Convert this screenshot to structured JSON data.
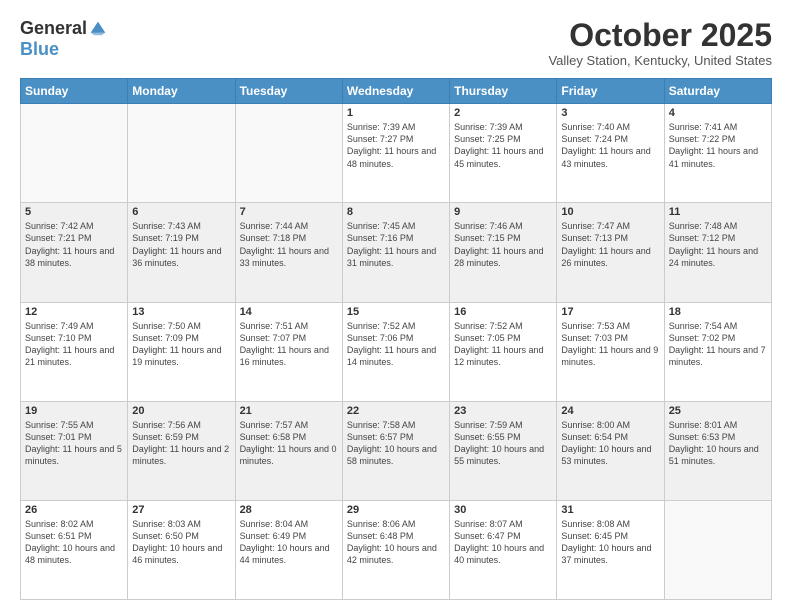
{
  "logo": {
    "general": "General",
    "blue": "Blue"
  },
  "header": {
    "month": "October 2025",
    "location": "Valley Station, Kentucky, United States"
  },
  "weekdays": [
    "Sunday",
    "Monday",
    "Tuesday",
    "Wednesday",
    "Thursday",
    "Friday",
    "Saturday"
  ],
  "weeks": [
    [
      {
        "day": "",
        "info": ""
      },
      {
        "day": "",
        "info": ""
      },
      {
        "day": "",
        "info": ""
      },
      {
        "day": "1",
        "info": "Sunrise: 7:39 AM\nSunset: 7:27 PM\nDaylight: 11 hours and 48 minutes."
      },
      {
        "day": "2",
        "info": "Sunrise: 7:39 AM\nSunset: 7:25 PM\nDaylight: 11 hours and 45 minutes."
      },
      {
        "day": "3",
        "info": "Sunrise: 7:40 AM\nSunset: 7:24 PM\nDaylight: 11 hours and 43 minutes."
      },
      {
        "day": "4",
        "info": "Sunrise: 7:41 AM\nSunset: 7:22 PM\nDaylight: 11 hours and 41 minutes."
      }
    ],
    [
      {
        "day": "5",
        "info": "Sunrise: 7:42 AM\nSunset: 7:21 PM\nDaylight: 11 hours and 38 minutes."
      },
      {
        "day": "6",
        "info": "Sunrise: 7:43 AM\nSunset: 7:19 PM\nDaylight: 11 hours and 36 minutes."
      },
      {
        "day": "7",
        "info": "Sunrise: 7:44 AM\nSunset: 7:18 PM\nDaylight: 11 hours and 33 minutes."
      },
      {
        "day": "8",
        "info": "Sunrise: 7:45 AM\nSunset: 7:16 PM\nDaylight: 11 hours and 31 minutes."
      },
      {
        "day": "9",
        "info": "Sunrise: 7:46 AM\nSunset: 7:15 PM\nDaylight: 11 hours and 28 minutes."
      },
      {
        "day": "10",
        "info": "Sunrise: 7:47 AM\nSunset: 7:13 PM\nDaylight: 11 hours and 26 minutes."
      },
      {
        "day": "11",
        "info": "Sunrise: 7:48 AM\nSunset: 7:12 PM\nDaylight: 11 hours and 24 minutes."
      }
    ],
    [
      {
        "day": "12",
        "info": "Sunrise: 7:49 AM\nSunset: 7:10 PM\nDaylight: 11 hours and 21 minutes."
      },
      {
        "day": "13",
        "info": "Sunrise: 7:50 AM\nSunset: 7:09 PM\nDaylight: 11 hours and 19 minutes."
      },
      {
        "day": "14",
        "info": "Sunrise: 7:51 AM\nSunset: 7:07 PM\nDaylight: 11 hours and 16 minutes."
      },
      {
        "day": "15",
        "info": "Sunrise: 7:52 AM\nSunset: 7:06 PM\nDaylight: 11 hours and 14 minutes."
      },
      {
        "day": "16",
        "info": "Sunrise: 7:52 AM\nSunset: 7:05 PM\nDaylight: 11 hours and 12 minutes."
      },
      {
        "day": "17",
        "info": "Sunrise: 7:53 AM\nSunset: 7:03 PM\nDaylight: 11 hours and 9 minutes."
      },
      {
        "day": "18",
        "info": "Sunrise: 7:54 AM\nSunset: 7:02 PM\nDaylight: 11 hours and 7 minutes."
      }
    ],
    [
      {
        "day": "19",
        "info": "Sunrise: 7:55 AM\nSunset: 7:01 PM\nDaylight: 11 hours and 5 minutes."
      },
      {
        "day": "20",
        "info": "Sunrise: 7:56 AM\nSunset: 6:59 PM\nDaylight: 11 hours and 2 minutes."
      },
      {
        "day": "21",
        "info": "Sunrise: 7:57 AM\nSunset: 6:58 PM\nDaylight: 11 hours and 0 minutes."
      },
      {
        "day": "22",
        "info": "Sunrise: 7:58 AM\nSunset: 6:57 PM\nDaylight: 10 hours and 58 minutes."
      },
      {
        "day": "23",
        "info": "Sunrise: 7:59 AM\nSunset: 6:55 PM\nDaylight: 10 hours and 55 minutes."
      },
      {
        "day": "24",
        "info": "Sunrise: 8:00 AM\nSunset: 6:54 PM\nDaylight: 10 hours and 53 minutes."
      },
      {
        "day": "25",
        "info": "Sunrise: 8:01 AM\nSunset: 6:53 PM\nDaylight: 10 hours and 51 minutes."
      }
    ],
    [
      {
        "day": "26",
        "info": "Sunrise: 8:02 AM\nSunset: 6:51 PM\nDaylight: 10 hours and 48 minutes."
      },
      {
        "day": "27",
        "info": "Sunrise: 8:03 AM\nSunset: 6:50 PM\nDaylight: 10 hours and 46 minutes."
      },
      {
        "day": "28",
        "info": "Sunrise: 8:04 AM\nSunset: 6:49 PM\nDaylight: 10 hours and 44 minutes."
      },
      {
        "day": "29",
        "info": "Sunrise: 8:06 AM\nSunset: 6:48 PM\nDaylight: 10 hours and 42 minutes."
      },
      {
        "day": "30",
        "info": "Sunrise: 8:07 AM\nSunset: 6:47 PM\nDaylight: 10 hours and 40 minutes."
      },
      {
        "day": "31",
        "info": "Sunrise: 8:08 AM\nSunset: 6:45 PM\nDaylight: 10 hours and 37 minutes."
      },
      {
        "day": "",
        "info": ""
      }
    ]
  ],
  "shading": [
    false,
    true,
    false,
    true,
    false
  ]
}
